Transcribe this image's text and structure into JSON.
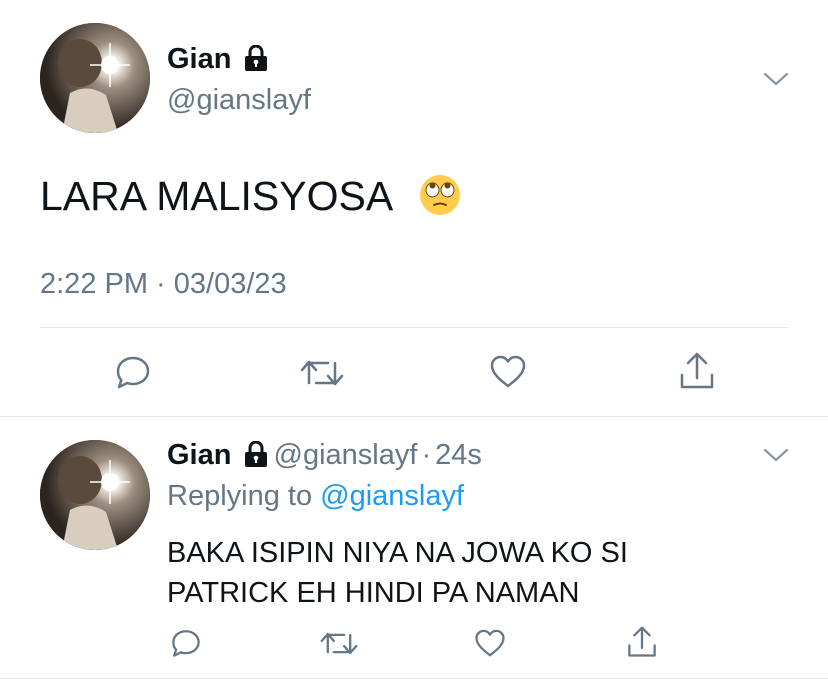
{
  "main_tweet": {
    "display_name": "Gian",
    "handle": "@gianslayf",
    "text": "LARA MALISYOSA",
    "emoji": "🙄",
    "timestamp": "2:22 PM · 03/03/23",
    "locked_icon": "lock-icon",
    "menu_icon": "chevron-down-icon"
  },
  "actions": [
    "reply-icon",
    "retweet-icon",
    "like-icon",
    "share-icon"
  ],
  "reply_tweet": {
    "display_name": "Gian",
    "handle": "@gianslayf",
    "separator": "·",
    "time_ago": "24s",
    "replying_prefix": "Replying to",
    "replying_handle": "@gianslayf",
    "text_line1": "BAKA ISIPIN NIYA NA JOWA KO SI",
    "text_line2": "PATRICK EH HINDI PA NAMAN",
    "menu_icon": "chevron-down-icon"
  },
  "colors": {
    "text": "#0f1419",
    "muted": "#657786",
    "link": "#1d9bf0",
    "divider": "#e1e8ed"
  }
}
